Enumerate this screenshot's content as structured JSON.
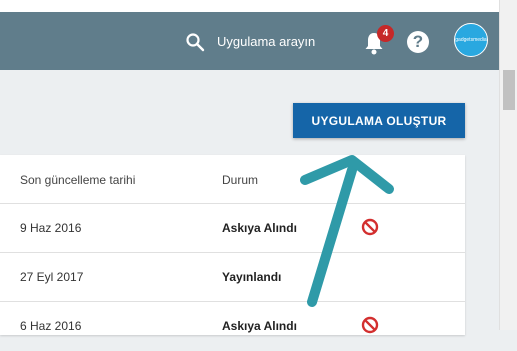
{
  "header": {
    "search_placeholder": "Uygulama arayın",
    "notification_count": "4",
    "help_symbol": "?",
    "avatar_text": "gadgetsmedia",
    "color": "#607d8b"
  },
  "actions": {
    "create_app_label": "UYGULAMA OLUŞTUR",
    "color": "#1565a8"
  },
  "table": {
    "columns": [
      "Son güncelleme tarihi",
      "Durum"
    ],
    "rows": [
      {
        "date": "9 Haz 2016",
        "status": "Askıya Alındı",
        "icon": "blocked-icon"
      },
      {
        "date": "27 Eyl 2017",
        "status": "Yayınlandı",
        "icon": ""
      },
      {
        "date": "6 Haz 2016",
        "status": "Askıya Alındı",
        "icon": "blocked-icon"
      }
    ]
  },
  "annotation": {
    "color": "#2f9aa8"
  }
}
